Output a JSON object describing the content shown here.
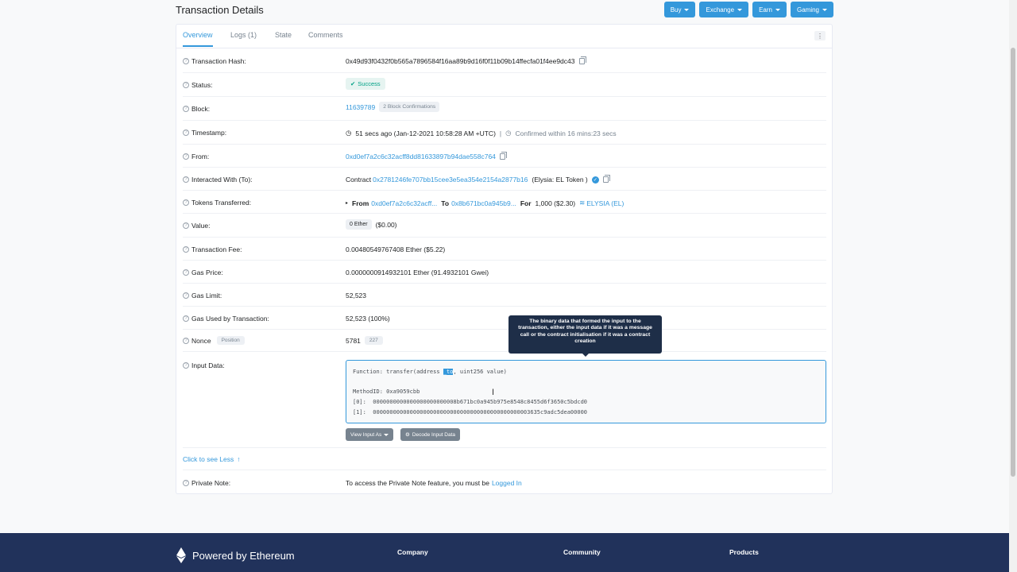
{
  "header": {
    "title": "Transaction Details",
    "buttons": [
      "Buy",
      "Exchange",
      "Earn",
      "Gaming"
    ]
  },
  "tabs": [
    "Overview",
    "Logs (1)",
    "State",
    "Comments"
  ],
  "rows": {
    "hash": {
      "label": "Transaction Hash:",
      "value": "0x49d93f0432f0b565a7896584f16aa89b9d16f0f11b09b14ffecfa01f4ee9dc43"
    },
    "status": {
      "label": "Status:",
      "value": "Success"
    },
    "block": {
      "label": "Block:",
      "value": "11639789",
      "confirmations": "2 Block Confirmations"
    },
    "timestamp": {
      "label": "Timestamp:",
      "value": "51 secs ago (Jan-12-2021 10:58:28 AM +UTC)",
      "sep": "|",
      "confirmed": "Confirmed within 16 mins:23 secs"
    },
    "from": {
      "label": "From:",
      "value": "0xd0ef7a2c6c32acff8dd81633897b94dae558c764"
    },
    "to": {
      "label": "Interacted With (To):",
      "prefix": "Contract",
      "address": "0x2781246fe707bb15cee3e5ea354e2154a2877b16",
      "name": "(Elysia: EL Token )"
    },
    "tokens": {
      "label": "Tokens Transferred:",
      "from_label": "From",
      "from": "0xd0ef7a2c6c32acff...",
      "to_label": "To",
      "to": "0x8b671bc0a945b9...",
      "for_label": "For",
      "amount": "1,000 ($2.30)",
      "token": "ELYSIA (EL)"
    },
    "value": {
      "label": "Value:",
      "amount": "0 Ether",
      "usd": "($0.00)"
    },
    "fee": {
      "label": "Transaction Fee:",
      "value": "0.00480549767408 Ether ($5.22)"
    },
    "gasprice": {
      "label": "Gas Price:",
      "value": "0.0000000914932101 Ether (91.4932101 Gwei)"
    },
    "gaslimit": {
      "label": "Gas Limit:",
      "value": "52,523"
    },
    "gasused": {
      "label": "Gas Used by Transaction:",
      "value": "52,523 (100%)"
    },
    "nonce": {
      "label": "Nonce",
      "position_label": "Position",
      "value": "5781",
      "position": "227"
    },
    "input": {
      "label": "Input Data:"
    }
  },
  "input_data": {
    "fn_pre": "Function: transfer(address ",
    "fn_sel": "_to",
    "fn_post": ", uint256 value)",
    "method": "MethodID: 0xa9059cbb",
    "arg0": "[0]:  0000000000000000000000008b671bc0a945b975e8548c8455d6f3650c5bdcd0",
    "arg1": "[1]:  00000000000000000000000000000000000000000000003635c9adc5dea00000"
  },
  "buttons": {
    "view_input": "View Input As",
    "decode": "Decode Input Data"
  },
  "tooltip": "The binary data that formed the input to the transaction, either the input data if it was a message call or the contract initialisation if it was a contract creation",
  "see_less": "Click to see Less",
  "note": {
    "label": "Private Note:",
    "text": "To access the Private Note feature, you must be",
    "link": "Logged In"
  },
  "footer": {
    "powered": "Powered by Ethereum",
    "cols": [
      "Company",
      "Community",
      "Products"
    ]
  },
  "colors": {
    "accent": "#3498db",
    "success": "#00a186",
    "footer": "#21325b"
  }
}
